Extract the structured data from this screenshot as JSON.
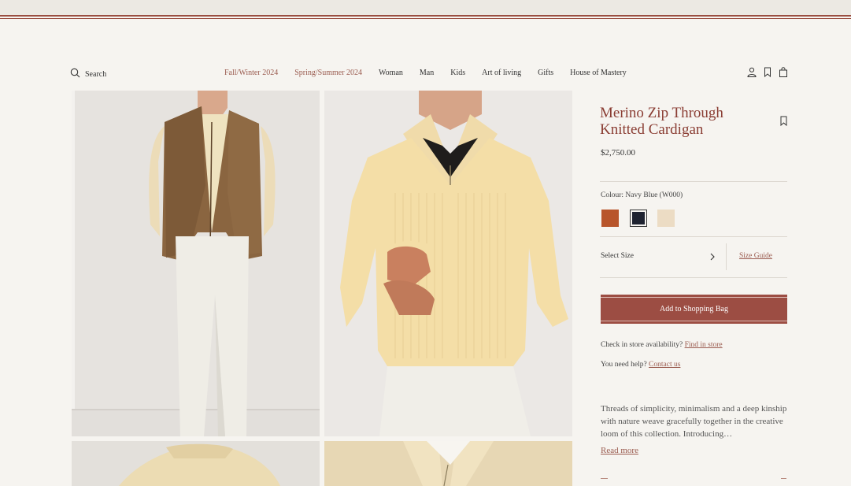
{
  "header": {
    "search_label": "Search",
    "nav": [
      "Fall/Winter 2024",
      "Spring/Summer 2024",
      "Woman",
      "Man",
      "Kids",
      "Art of living",
      "Gifts",
      "House of Mastery"
    ]
  },
  "product": {
    "title": "Merino Zip Through Knitted Cardigan",
    "price": "$2,750.00",
    "colour_label": "Colour:",
    "colour_value": "Navy Blue (W000)",
    "swatches": [
      {
        "name": "rust",
        "color": "#b8552b"
      },
      {
        "name": "navy",
        "color": "#1e2230"
      },
      {
        "name": "cream",
        "color": "#ecdcc4"
      }
    ],
    "size_label": "Select Size",
    "size_guide": "Size Guide",
    "add_to_bag": "Add to Shopping Bag",
    "store_check": "Check in store availability?",
    "find_in_store": "Find in store",
    "help": "You need help?",
    "contact": "Contact us",
    "description": "Threads of simplicity, minimalism and a deep kinship with nature weave gracefully together in the creative loom of this collection. Introducing…",
    "read_more": "Read more"
  },
  "colors": {
    "brand": "#9c4d43",
    "accent_text": "#9a5b4f",
    "background": "#f6f4f0"
  }
}
